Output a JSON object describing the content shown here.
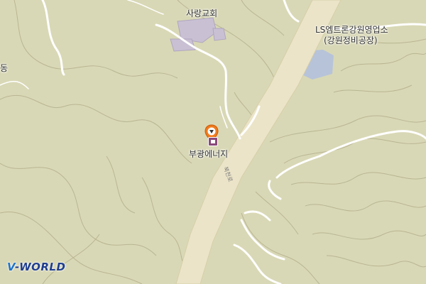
{
  "map": {
    "labels": {
      "church": "사랑교회",
      "company": "LS엠트론강원영업소",
      "company_sub": "(강원정비공장)",
      "poi": "부광에너지",
      "road": "북천로",
      "left_edge": "동"
    },
    "logo": {
      "v": "V",
      "rest": "-WORLD"
    },
    "colors": {
      "background": "#d9d8b6",
      "highway": "#ebe4c8",
      "road": "#ffffff",
      "water_block": "#b7c3d9",
      "building": "#c9c0d4",
      "marker": "#f07a1c",
      "poi_icon": "#8a4a7a"
    },
    "icons": [
      "location-marker-icon",
      "gas-station-icon"
    ]
  }
}
